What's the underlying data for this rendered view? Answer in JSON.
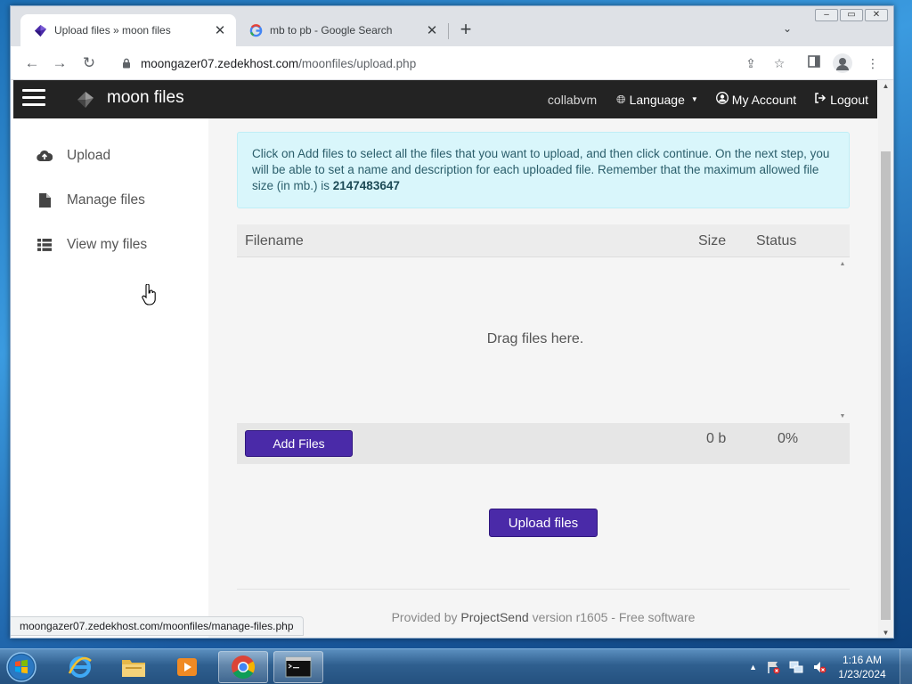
{
  "browser": {
    "tabs": [
      {
        "title": "Upload files » moon files",
        "active": true
      },
      {
        "title": "mb to pb - Google Search",
        "active": false
      }
    ],
    "new_tab": "+",
    "url_host": "moongazer07.zedekhost.com",
    "url_path": "/moonfiles/upload.php",
    "status_url": "moongazer07.zedekhost.com/moonfiles/manage-files.php"
  },
  "topnav": {
    "brand": "moon files",
    "user": "collabvm",
    "language": "Language",
    "account": "My Account",
    "logout": "Logout"
  },
  "sidebar": {
    "items": [
      {
        "label": "Upload",
        "icon": "cloud-upload-icon"
      },
      {
        "label": "Manage files",
        "icon": "file-icon"
      },
      {
        "label": "View my files",
        "icon": "list-icon"
      }
    ]
  },
  "main": {
    "info_text": "Click on Add files to select all the files that you want to upload, and then click continue. On the next step, you will be able to set a name and description for each uploaded file. Remember that the maximum allowed file size (in mb.) is ",
    "max_size": "2147483647",
    "uploader": {
      "col_filename": "Filename",
      "col_size": "Size",
      "col_status": "Status",
      "drop_text": "Drag files here.",
      "add_files": "Add Files",
      "total_size": "0 b",
      "total_percent": "0%"
    },
    "upload_button": "Upload files",
    "footer_prefix": "Provided by",
    "footer_link": "ProjectSend",
    "footer_suffix": "version r1605 - Free software"
  },
  "taskbar": {
    "time": "1:16 AM",
    "date": "1/23/2024"
  },
  "colors": {
    "accent": "#4a2aa8",
    "navbar": "#232323",
    "info_bg": "#d9f6fb"
  }
}
